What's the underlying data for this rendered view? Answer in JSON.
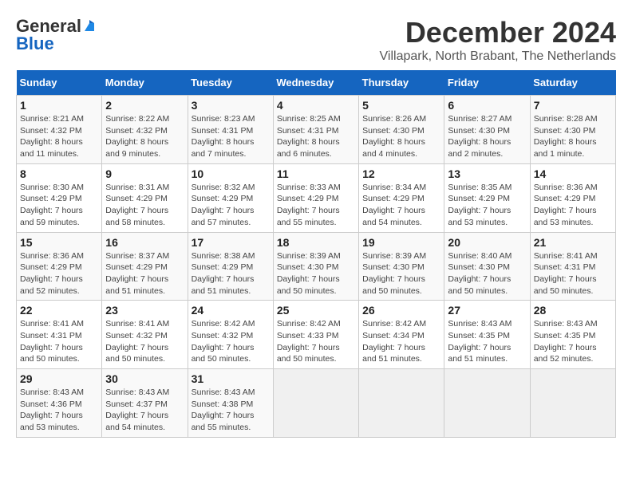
{
  "header": {
    "logo_general": "General",
    "logo_blue": "Blue",
    "month_title": "December 2024",
    "location": "Villapark, North Brabant, The Netherlands"
  },
  "weekdays": [
    "Sunday",
    "Monday",
    "Tuesday",
    "Wednesday",
    "Thursday",
    "Friday",
    "Saturday"
  ],
  "weeks": [
    [
      {
        "day": "1",
        "sunrise": "8:21 AM",
        "sunset": "4:32 PM",
        "daylight": "8 hours and 11 minutes."
      },
      {
        "day": "2",
        "sunrise": "8:22 AM",
        "sunset": "4:32 PM",
        "daylight": "8 hours and 9 minutes."
      },
      {
        "day": "3",
        "sunrise": "8:23 AM",
        "sunset": "4:31 PM",
        "daylight": "8 hours and 7 minutes."
      },
      {
        "day": "4",
        "sunrise": "8:25 AM",
        "sunset": "4:31 PM",
        "daylight": "8 hours and 6 minutes."
      },
      {
        "day": "5",
        "sunrise": "8:26 AM",
        "sunset": "4:30 PM",
        "daylight": "8 hours and 4 minutes."
      },
      {
        "day": "6",
        "sunrise": "8:27 AM",
        "sunset": "4:30 PM",
        "daylight": "8 hours and 2 minutes."
      },
      {
        "day": "7",
        "sunrise": "8:28 AM",
        "sunset": "4:30 PM",
        "daylight": "8 hours and 1 minute."
      }
    ],
    [
      {
        "day": "8",
        "sunrise": "8:30 AM",
        "sunset": "4:29 PM",
        "daylight": "7 hours and 59 minutes."
      },
      {
        "day": "9",
        "sunrise": "8:31 AM",
        "sunset": "4:29 PM",
        "daylight": "7 hours and 58 minutes."
      },
      {
        "day": "10",
        "sunrise": "8:32 AM",
        "sunset": "4:29 PM",
        "daylight": "7 hours and 57 minutes."
      },
      {
        "day": "11",
        "sunrise": "8:33 AM",
        "sunset": "4:29 PM",
        "daylight": "7 hours and 55 minutes."
      },
      {
        "day": "12",
        "sunrise": "8:34 AM",
        "sunset": "4:29 PM",
        "daylight": "7 hours and 54 minutes."
      },
      {
        "day": "13",
        "sunrise": "8:35 AM",
        "sunset": "4:29 PM",
        "daylight": "7 hours and 53 minutes."
      },
      {
        "day": "14",
        "sunrise": "8:36 AM",
        "sunset": "4:29 PM",
        "daylight": "7 hours and 53 minutes."
      }
    ],
    [
      {
        "day": "15",
        "sunrise": "8:36 AM",
        "sunset": "4:29 PM",
        "daylight": "7 hours and 52 minutes."
      },
      {
        "day": "16",
        "sunrise": "8:37 AM",
        "sunset": "4:29 PM",
        "daylight": "7 hours and 51 minutes."
      },
      {
        "day": "17",
        "sunrise": "8:38 AM",
        "sunset": "4:29 PM",
        "daylight": "7 hours and 51 minutes."
      },
      {
        "day": "18",
        "sunrise": "8:39 AM",
        "sunset": "4:30 PM",
        "daylight": "7 hours and 50 minutes."
      },
      {
        "day": "19",
        "sunrise": "8:39 AM",
        "sunset": "4:30 PM",
        "daylight": "7 hours and 50 minutes."
      },
      {
        "day": "20",
        "sunrise": "8:40 AM",
        "sunset": "4:30 PM",
        "daylight": "7 hours and 50 minutes."
      },
      {
        "day": "21",
        "sunrise": "8:41 AM",
        "sunset": "4:31 PM",
        "daylight": "7 hours and 50 minutes."
      }
    ],
    [
      {
        "day": "22",
        "sunrise": "8:41 AM",
        "sunset": "4:31 PM",
        "daylight": "7 hours and 50 minutes."
      },
      {
        "day": "23",
        "sunrise": "8:41 AM",
        "sunset": "4:32 PM",
        "daylight": "7 hours and 50 minutes."
      },
      {
        "day": "24",
        "sunrise": "8:42 AM",
        "sunset": "4:32 PM",
        "daylight": "7 hours and 50 minutes."
      },
      {
        "day": "25",
        "sunrise": "8:42 AM",
        "sunset": "4:33 PM",
        "daylight": "7 hours and 50 minutes."
      },
      {
        "day": "26",
        "sunrise": "8:42 AM",
        "sunset": "4:34 PM",
        "daylight": "7 hours and 51 minutes."
      },
      {
        "day": "27",
        "sunrise": "8:43 AM",
        "sunset": "4:35 PM",
        "daylight": "7 hours and 51 minutes."
      },
      {
        "day": "28",
        "sunrise": "8:43 AM",
        "sunset": "4:35 PM",
        "daylight": "7 hours and 52 minutes."
      }
    ],
    [
      {
        "day": "29",
        "sunrise": "8:43 AM",
        "sunset": "4:36 PM",
        "daylight": "7 hours and 53 minutes."
      },
      {
        "day": "30",
        "sunrise": "8:43 AM",
        "sunset": "4:37 PM",
        "daylight": "7 hours and 54 minutes."
      },
      {
        "day": "31",
        "sunrise": "8:43 AM",
        "sunset": "4:38 PM",
        "daylight": "7 hours and 55 minutes."
      },
      null,
      null,
      null,
      null
    ]
  ],
  "labels": {
    "sunrise": "Sunrise:",
    "sunset": "Sunset:",
    "daylight": "Daylight:"
  }
}
